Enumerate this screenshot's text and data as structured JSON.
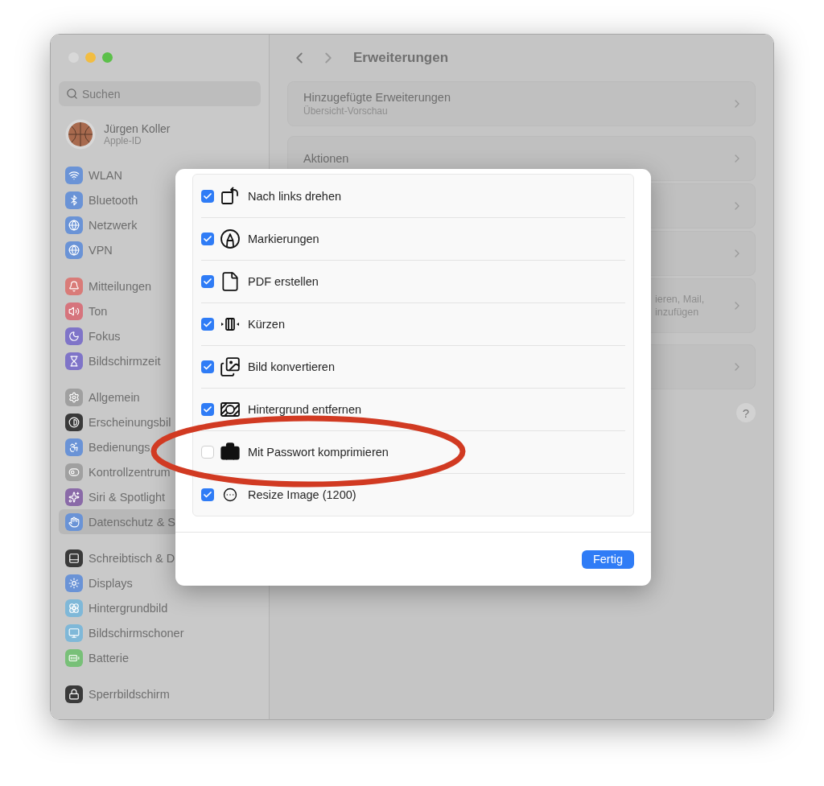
{
  "window": {
    "title": "Erweiterungen"
  },
  "sidebar": {
    "search": {
      "placeholder": "Suchen"
    },
    "account": {
      "name": "Jürgen Koller",
      "subtitle": "Apple-ID"
    },
    "groups": [
      [
        {
          "label": "WLAN",
          "color": "#6a93d6",
          "selected": false
        },
        {
          "label": "Bluetooth",
          "color": "#6a93d6",
          "selected": false
        },
        {
          "label": "Netzwerk",
          "color": "#6a93d6",
          "selected": false
        },
        {
          "label": "VPN",
          "color": "#6a93d6",
          "selected": false
        }
      ],
      [
        {
          "label": "Mitteilungen",
          "color": "#d97b78",
          "selected": false
        },
        {
          "label": "Ton",
          "color": "#d6747d",
          "selected": false
        },
        {
          "label": "Fokus",
          "color": "#7f74c8",
          "selected": false
        },
        {
          "label": "Bildschirmzeit",
          "color": "#7f74c8",
          "selected": false
        }
      ],
      [
        {
          "label": "Allgemein",
          "color": "#a0a0a0",
          "selected": false
        },
        {
          "label": "Erscheinungsbil",
          "color": "#3a3a3a",
          "selected": false
        },
        {
          "label": "Bedienungs",
          "color": "#6a93d6",
          "selected": false
        },
        {
          "label": "Kontrollzentrum",
          "color": "#a0a0a0",
          "selected": false
        },
        {
          "label": "Siri & Spotlight",
          "color": "#8a6aa8",
          "selected": false
        },
        {
          "label": "Datenschutz & S",
          "color": "#6a93d6",
          "selected": true
        }
      ],
      [
        {
          "label": "Schreibtisch & D",
          "color": "#3a3a3a",
          "selected": false
        },
        {
          "label": "Displays",
          "color": "#6a93d6",
          "selected": false
        },
        {
          "label": "Hintergrundbild",
          "color": "#7fb8d8",
          "selected": false
        },
        {
          "label": "Bildschirmschoner",
          "color": "#7fb8d8",
          "selected": false
        },
        {
          "label": "Batterie",
          "color": "#78c078",
          "selected": false
        }
      ],
      [
        {
          "label": "Sperrbildschirm",
          "color": "#3a3a3a",
          "selected": false
        }
      ]
    ]
  },
  "main": {
    "rows": [
      {
        "kind": "full",
        "title": "Hinzugefügte Erweiterungen",
        "subtitle": "Übersicht-Vorschau"
      },
      {
        "kind": "full",
        "title": "Aktionen"
      },
      {
        "kind": "covered"
      },
      {
        "kind": "covered"
      },
      {
        "kind": "partly_covered",
        "lines": [
          "ieren, Mail,",
          "inzufügen"
        ]
      },
      {
        "kind": "covered"
      }
    ],
    "help": "?"
  },
  "dialog": {
    "items": [
      {
        "label": "Nach links drehen",
        "checked": true
      },
      {
        "label": "Markierungen",
        "checked": true
      },
      {
        "label": "PDF erstellen",
        "checked": true
      },
      {
        "label": "Kürzen",
        "checked": true
      },
      {
        "label": "Bild konvertieren",
        "checked": true
      },
      {
        "label": "Hintergrund entfernen",
        "checked": true
      },
      {
        "label": "Mit Passwort komprimieren",
        "checked": false
      },
      {
        "label": "Resize Image (1200)",
        "checked": true
      }
    ],
    "button": "Fertig"
  },
  "annotation": {
    "kind": "ellipse"
  }
}
